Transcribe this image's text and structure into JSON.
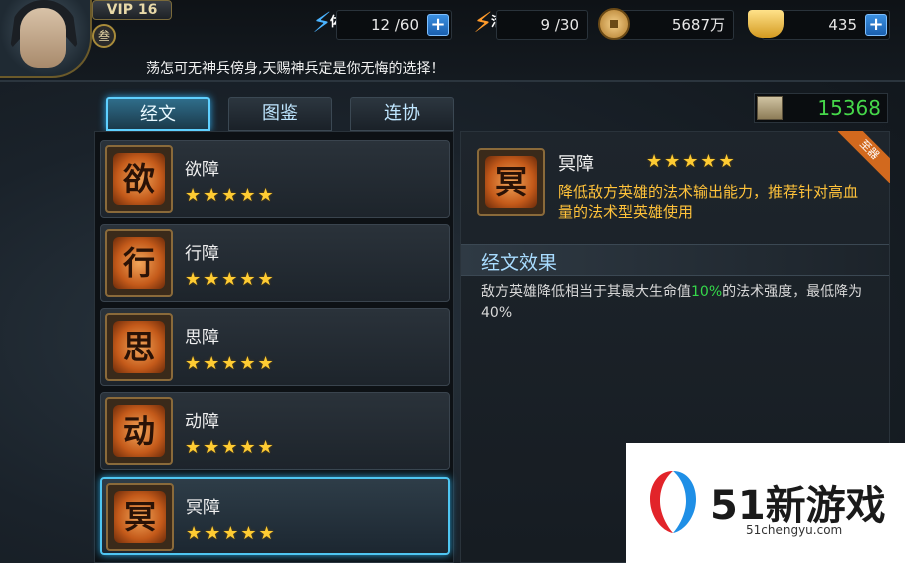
{
  "player": {
    "vip_label": "VIP 16",
    "rank_badge": "叁"
  },
  "resources": {
    "stamina": {
      "icon_label": "体",
      "value": "12 /60"
    },
    "energy": {
      "icon_label": "活",
      "value": "9 /30"
    },
    "copper": {
      "value": "5687万"
    },
    "gold": {
      "value": "435"
    }
  },
  "marquee_text": "荡怎可无神兵傍身,天赐神兵定是你无悔的选择！",
  "tabs": [
    {
      "label": "经文",
      "active": true
    },
    {
      "label": "图鉴",
      "active": false
    },
    {
      "label": "连协",
      "active": false
    }
  ],
  "scroll_count": "15368",
  "scriptures": [
    {
      "name": "欲障",
      "stars": "★★★★★",
      "glyph": "欲",
      "selected": false
    },
    {
      "name": "行障",
      "stars": "★★★★★",
      "glyph": "行",
      "selected": false
    },
    {
      "name": "思障",
      "stars": "★★★★★",
      "glyph": "思",
      "selected": false
    },
    {
      "name": "动障",
      "stars": "★★★★★",
      "glyph": "动",
      "selected": false
    },
    {
      "name": "冥障",
      "stars": "★★★★★",
      "glyph": "冥",
      "selected": true
    }
  ],
  "detail": {
    "title": "冥障",
    "stars": "★★★★★",
    "glyph": "冥",
    "ribbon": "至器",
    "summary": "降低敌方英雄的法术输出能力，推荐针对高血量的法术型英雄使用",
    "section_title": "经文效果",
    "effect_before": "敌方英雄降低相当于其最大生命值",
    "effect_highlight": "10%",
    "effect_after": "的法术强度，最低降为40%"
  },
  "watermark": {
    "brand": "51新游戏",
    "url": "51chengyu.com"
  },
  "colors": {
    "accent_blue": "#4fc6f2",
    "star_gold": "#ffcc33",
    "summary_gold": "#ffc23a",
    "highlight_green": "#35d84a",
    "score_green": "#46d84a"
  }
}
